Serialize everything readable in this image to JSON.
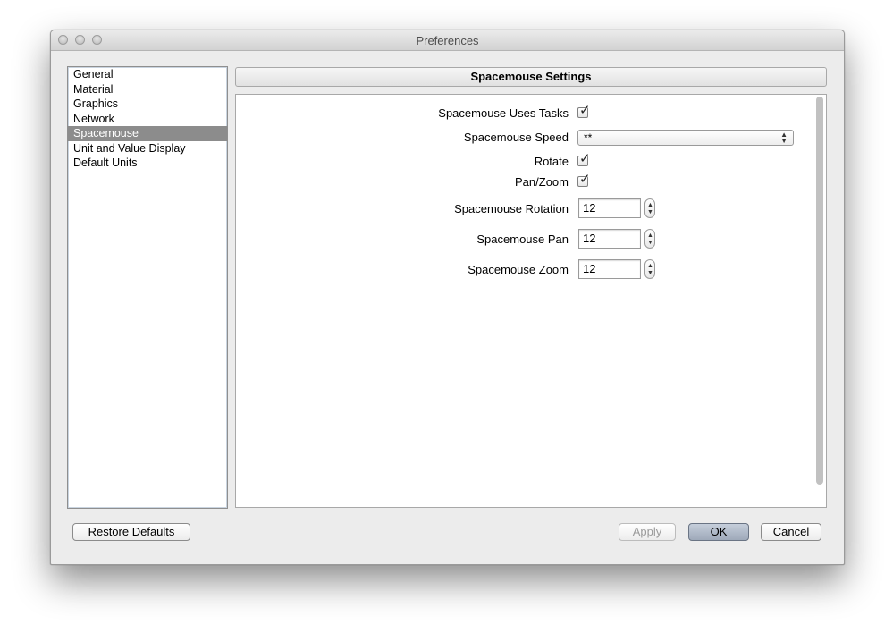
{
  "window": {
    "title": "Preferences"
  },
  "sidebar": {
    "items": [
      {
        "label": "General"
      },
      {
        "label": "Material"
      },
      {
        "label": "Graphics"
      },
      {
        "label": "Network"
      },
      {
        "label": "Spacemouse",
        "selected": true
      },
      {
        "label": "Unit and Value Display"
      },
      {
        "label": "Default Units"
      }
    ]
  },
  "panel": {
    "title": "Spacemouse Settings",
    "uses_tasks": {
      "label": "Spacemouse Uses Tasks",
      "checked": true
    },
    "speed": {
      "label": "Spacemouse Speed",
      "value": "**"
    },
    "rotate": {
      "label": "Rotate",
      "checked": true
    },
    "pan_zoom": {
      "label": "Pan/Zoom",
      "checked": true
    },
    "rotation": {
      "label": "Spacemouse Rotation",
      "value": "12"
    },
    "pan": {
      "label": "Spacemouse Pan",
      "value": "12"
    },
    "zoom": {
      "label": "Spacemouse Zoom",
      "value": "12"
    }
  },
  "buttons": {
    "restore_defaults": "Restore Defaults",
    "apply": "Apply",
    "ok": "OK",
    "cancel": "Cancel"
  },
  "icons": {
    "check": "✓",
    "select_arrows": "▲▼",
    "stepper_up": "▲",
    "stepper_down": "▼"
  },
  "colors": {
    "selection": "#8c8c8c",
    "default_button": "#a9b4c4"
  }
}
